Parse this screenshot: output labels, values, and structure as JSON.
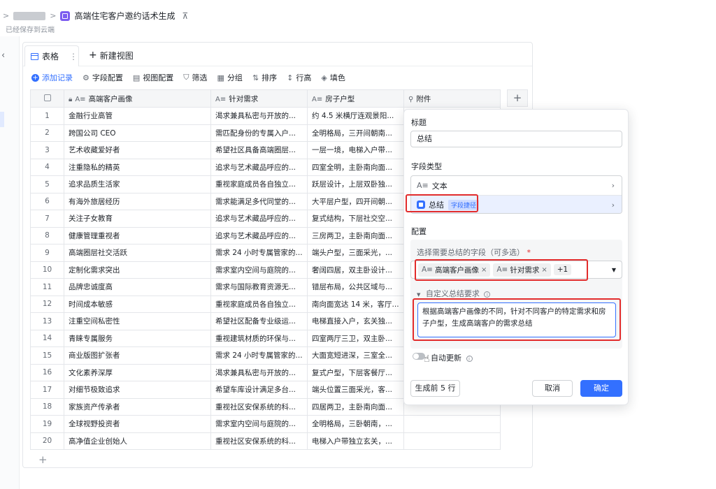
{
  "header": {
    "breadcrumb_title": "高端住宅客户邀约话术生成",
    "save_status": "已经保存到云端"
  },
  "view": {
    "active_tab": "表格",
    "new_view": "新建视图"
  },
  "toolbar": {
    "add_record": "添加记录",
    "field_config": "字段配置",
    "view_config": "视图配置",
    "filter": "筛选",
    "group": "分组",
    "sort": "排序",
    "row_height": "行高",
    "fill": "填色"
  },
  "columns": [
    "高端客户画像",
    "针对需求",
    "房子户型",
    "附件"
  ],
  "rows": [
    [
      "1",
      "金融行业高管",
      "渴求兼具私密与开放的...",
      "约 4.5 米横厅连观景阳..."
    ],
    [
      "2",
      "跨国公司 CEO",
      "需匹配身份的专属入户...",
      "全明格局，三开间朝南..."
    ],
    [
      "3",
      "艺术收藏爱好者",
      "希望社区具备高端圈层...",
      "一层一境，电梯入户带..."
    ],
    [
      "4",
      "注重隐私的精英",
      "追求与艺术藏品呼应的...",
      "四室全明，主卧南向面..."
    ],
    [
      "5",
      "追求品质生活家",
      "重视家庭成员各自独立...",
      "跃层设计，上层双卧独..."
    ],
    [
      "6",
      "有海外旅居经历",
      "需求能满足多代同堂的...",
      "大平层户型，四开间朝..."
    ],
    [
      "7",
      "关注子女教育",
      "追求与艺术藏品呼应的...",
      "复式结构，下层社交空..."
    ],
    [
      "8",
      "健康管理重视者",
      "追求与艺术藏品呼应的...",
      "三房两卫，主卧南向面..."
    ],
    [
      "9",
      "高端圈层社交活跃",
      "需求 24 小时专属管家的...",
      "端头户型，三面采光，..."
    ],
    [
      "10",
      "定制化需求突出",
      "需求室内空间与庭院的...",
      "奢阔四居，双主卧设计..."
    ],
    [
      "11",
      "品牌忠诚度高",
      "需求与国际教育资源无...",
      "错层布局，公共区域与..."
    ],
    [
      "12",
      "时间成本敏感",
      "重视家庭成员各自独立...",
      "南向面宽达 14 米，客厅..."
    ],
    [
      "13",
      "注重空间私密性",
      "希望社区配备专业级运...",
      "电梯直接入户，玄关独..."
    ],
    [
      "14",
      "青睐专属服务",
      "重视建筑材质的环保与...",
      "四室两厅三卫，双主卧..."
    ],
    [
      "15",
      "商业版图扩张者",
      "需求 24 小时专属管家的...",
      "大面宽短进深，三室全..."
    ],
    [
      "16",
      "文化素养深厚",
      "渴求兼具私密与开放的...",
      "复式户型，下层客餐厅..."
    ],
    [
      "17",
      "对细节极致追求",
      "希望车库设计满足多台...",
      "端头位置三面采光，客..."
    ],
    [
      "18",
      "家族资产传承者",
      "重视社区安保系统的科...",
      "四居两卫，主卧南向面..."
    ],
    [
      "19",
      "全球视野投资者",
      "需求室内空间与庭院的...",
      "全明格局，三卧朝南，..."
    ],
    [
      "20",
      "高净值企业创始人",
      "重视社区安保系统的科...",
      "电梯入户带独立玄关，..."
    ]
  ],
  "panel": {
    "title_label": "标题",
    "title_value": "总结",
    "field_type_label": "字段类型",
    "type_text": "文本",
    "type_summary": "总结",
    "type_summary_badge": "字段捷径",
    "config_label": "配置",
    "select_fields_label": "选择需要总结的字段（可多选）",
    "required_mark": "*",
    "chip1": "高端客户画像",
    "chip2": "针对需求",
    "chip_more": "+1",
    "custom_req_label": "自定义总结要求",
    "custom_req_text": "根据高端客户画像的不同，针对不同客户的特定需求和房子户型，生成高端客户的需求总结",
    "auto_update_label": "自动更新",
    "gen_preview": "生成前 5 行",
    "cancel": "取消",
    "confirm": "确定"
  },
  "colors": {
    "accent": "#3370ff",
    "highlight": "#e22c2c"
  }
}
